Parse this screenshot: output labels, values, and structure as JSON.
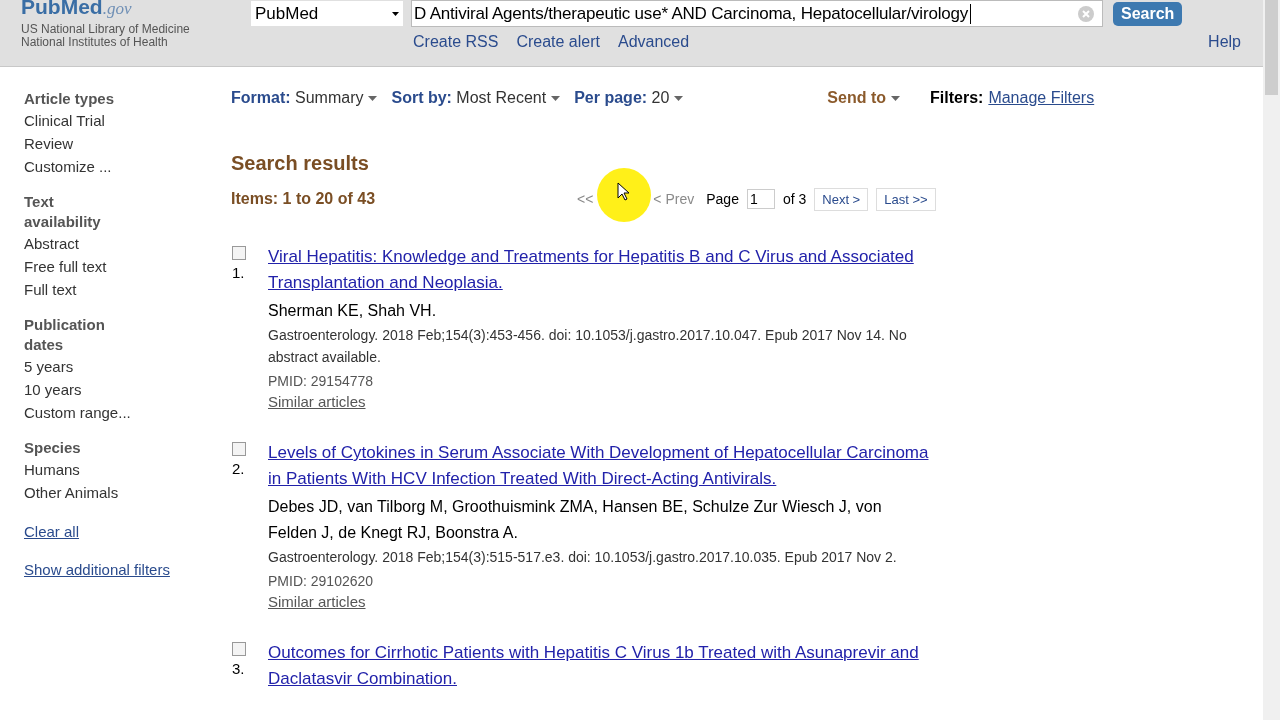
{
  "header": {
    "logo": {
      "name": "PubMed",
      "suffix": ".gov"
    },
    "org_lines": [
      "US National Library of Medicine",
      "National Institutes of Health"
    ],
    "database": "PubMed",
    "query": "D Antiviral Agents/therapeutic use* AND Carcinoma, Hepatocellular/virology",
    "search_button": "Search",
    "links": [
      "Create RSS",
      "Create alert",
      "Advanced"
    ],
    "help": "Help"
  },
  "sidebar": {
    "groups": [
      {
        "title": "Article types",
        "items": [
          "Clinical Trial",
          "Review",
          "Customize ..."
        ]
      },
      {
        "title": "Text availability",
        "items": [
          "Abstract",
          "Free full text",
          "Full text"
        ]
      },
      {
        "title": "Publication dates",
        "items": [
          "5 years",
          "10 years",
          "Custom range..."
        ]
      },
      {
        "title": "Species",
        "items": [
          "Humans",
          "Other Animals"
        ]
      }
    ],
    "links": [
      "Clear all",
      "Show additional filters"
    ]
  },
  "toolbar": {
    "options": [
      {
        "label": "Format:",
        "value": "Summary"
      },
      {
        "label": "Sort by:",
        "value": "Most Recent"
      },
      {
        "label": "Per page:",
        "value": "20"
      }
    ],
    "send_to": "Send to",
    "filters_label": "Filters:",
    "filters_link": "Manage Filters"
  },
  "results": {
    "heading": "Search results",
    "count": "Items: 1 to 20 of 43",
    "pager": {
      "first": "<<",
      "prev": "< Prev",
      "page_label": "Page",
      "page": "1",
      "of": "of 3",
      "next": "Next >",
      "last": "Last >>"
    },
    "items": [
      {
        "number": "1.",
        "checked": false,
        "title": "Viral Hepatitis: Knowledge and Treatments for Hepatitis B and C Virus and Associated Transplantation and Neoplasia.",
        "authors": "Sherman KE, Shah VH.",
        "citation": "Gastroenterology. 2018 Feb;154(3):453-456. doi: 10.1053/j.gastro.2017.10.047. Epub 2017 Nov 14. No abstract available.",
        "pmid": "PMID: 29154778",
        "similar": "Similar articles"
      },
      {
        "number": "2.",
        "checked": false,
        "title": "Levels of Cytokines in Serum Associate With Development of Hepatocellular Carcinoma in Patients With HCV Infection Treated With Direct-Acting Antivirals.",
        "authors": "Debes JD, van Tilborg M, Groothuismink ZMA, Hansen BE, Schulze Zur Wiesch J, von Felden J, de Knegt RJ, Boonstra A.",
        "citation": "Gastroenterology. 2018 Feb;154(3):515-517.e3. doi: 10.1053/j.gastro.2017.10.035. Epub 2017 Nov 2.",
        "pmid": "PMID: 29102620",
        "similar": "Similar articles"
      },
      {
        "number": "3.",
        "checked": false,
        "title": "Outcomes for Cirrhotic Patients with Hepatitis C Virus 1b Treated with Asunaprevir and Daclatasvir Combination."
      }
    ]
  }
}
